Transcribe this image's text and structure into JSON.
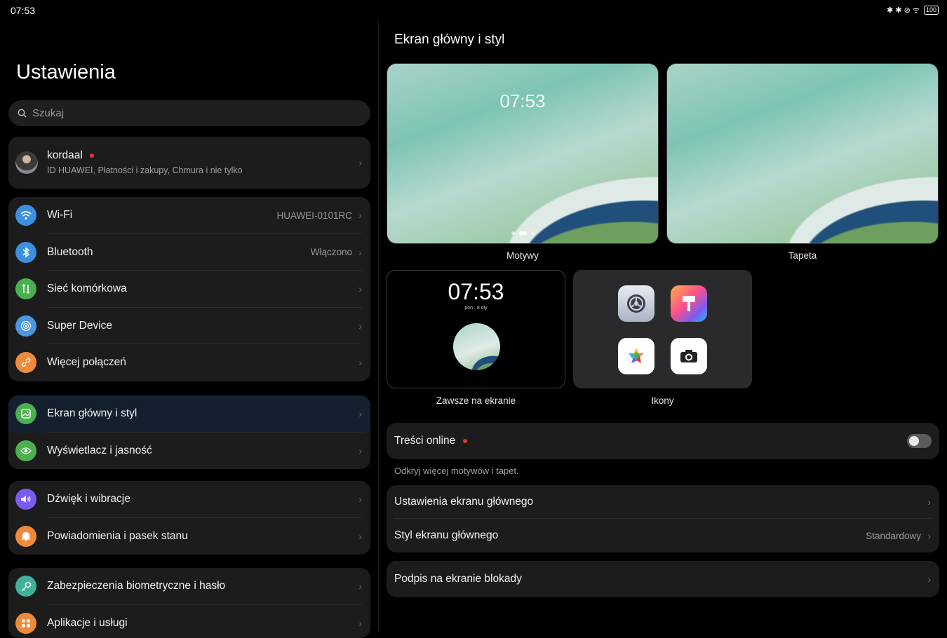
{
  "status": {
    "time": "07:53",
    "icons": "✱ ✱ ⊘ ᯤ",
    "battery": "100"
  },
  "sidebar": {
    "title": "Ustawienia",
    "search_placeholder": "Szukaj",
    "profile": {
      "name": "kordaal",
      "subtitle": "ID HUAWEI, Płatności i zakupy, Chmura i nie tylko"
    },
    "groups": [
      [
        {
          "label": "Wi-Fi",
          "value": "HUAWEI-0101RC",
          "icon": "wifi-icon",
          "color": "#3d8fe0"
        },
        {
          "label": "Bluetooth",
          "value": "Włączono",
          "icon": "bluetooth-icon",
          "color": "#3d8fe0"
        },
        {
          "label": "Sieć komórkowa",
          "value": "",
          "icon": "cellular-icon",
          "color": "#4caf50"
        },
        {
          "label": "Super Device",
          "value": "",
          "icon": "super-device-icon",
          "color": "#3d8fe0"
        },
        {
          "label": "Więcej połączeń",
          "value": "",
          "icon": "link-icon",
          "color": "#f08a3a"
        }
      ],
      [
        {
          "label": "Ekran główny i styl",
          "value": "",
          "icon": "home-style-icon",
          "color": "#4caf50"
        },
        {
          "label": "Wyświetlacz i jasność",
          "value": "",
          "icon": "eye-icon",
          "color": "#4caf50"
        }
      ],
      [
        {
          "label": "Dźwięk i wibracje",
          "value": "",
          "icon": "sound-icon",
          "color": "#7a5cf0"
        },
        {
          "label": "Powiadomienia i pasek stanu",
          "value": "",
          "icon": "bell-icon",
          "color": "#f08a3a"
        }
      ],
      [
        {
          "label": "Zabezpieczenia biometryczne i hasło",
          "value": "",
          "icon": "key-icon",
          "color": "#3fb09a"
        },
        {
          "label": "Aplikacje i usługi",
          "value": "",
          "icon": "apps-icon",
          "color": "#f08a3a"
        }
      ]
    ]
  },
  "main": {
    "title": "Ekran główny i styl",
    "themes_label": "Motywy",
    "wallpaper_label": "Tapeta",
    "theme_clock": "07:53",
    "aod": {
      "label": "Zawsze na ekranie",
      "time": "07:53",
      "date": "pon., 8 sty"
    },
    "icons_label": "Ikony",
    "online": {
      "label": "Treści online",
      "hint": "Odkryj więcej motywów i tapet."
    },
    "home_settings": "Ustawienia ekranu głównego",
    "home_style": {
      "label": "Styl ekranu głównego",
      "value": "Standardowy"
    },
    "lock_signature": "Podpis na ekranie blokady"
  }
}
